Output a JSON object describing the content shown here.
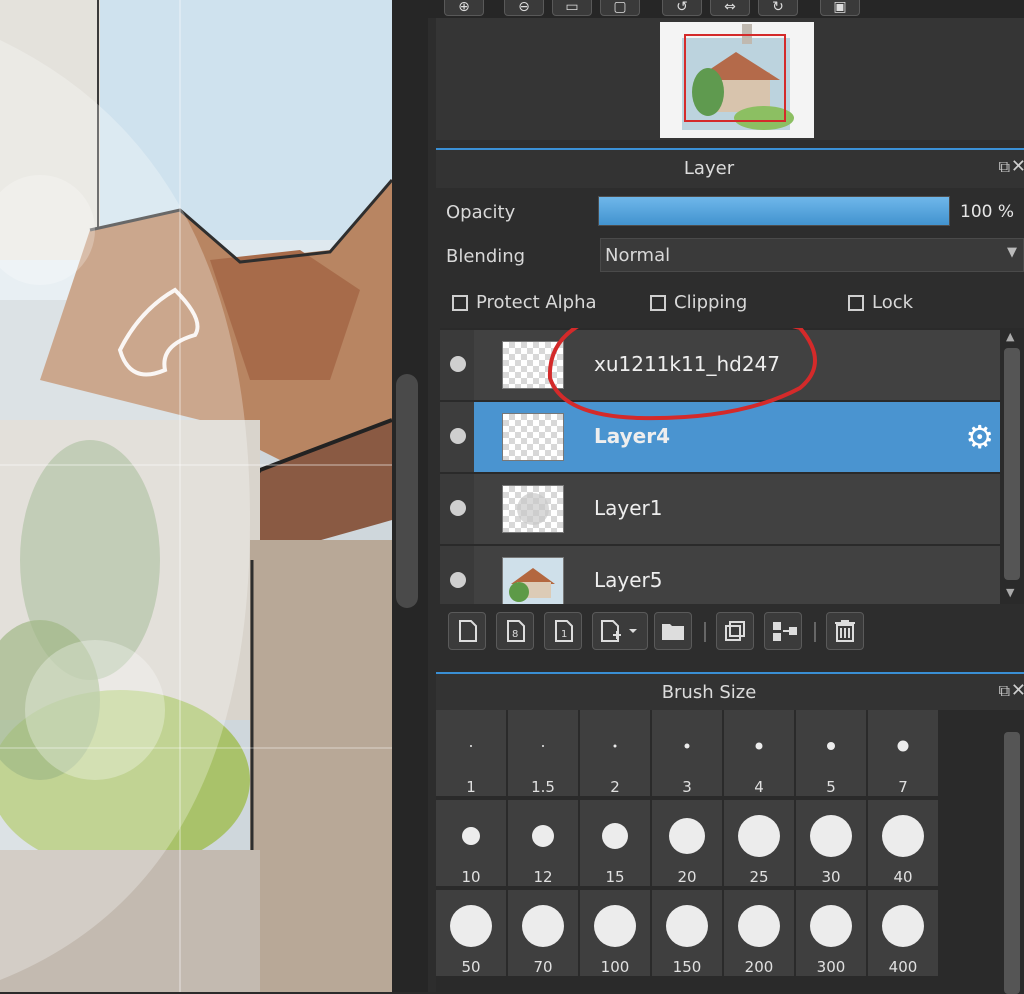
{
  "navigator": {
    "toolbar_icons": [
      "zoom-in-icon",
      "zoom-out-icon",
      "fit-icon",
      "actual-size-icon",
      "rotate-left-icon",
      "flip-icon",
      "rotate-right-icon",
      "reset-icon"
    ]
  },
  "layer_panel": {
    "title": "Layer",
    "opacity_label": "Opacity",
    "opacity_value": "100 %",
    "opacity_fraction": 1.0,
    "blending_label": "Blending",
    "blending_value": "Normal",
    "protect_alpha_label": "Protect Alpha",
    "clipping_label": "Clipping",
    "lock_label": "Lock",
    "layers": [
      {
        "name": "xu1211k11_hd247",
        "selected": false
      },
      {
        "name": "Layer4",
        "selected": true
      },
      {
        "name": "Layer1",
        "selected": false
      },
      {
        "name": "Layer5",
        "selected": false
      }
    ],
    "accent_color": "#4a94d0",
    "annotation_color": "#d42a2a"
  },
  "brush_panel": {
    "title": "Brush Size",
    "sizes": [
      "1",
      "1.5",
      "2",
      "3",
      "4",
      "5",
      "7",
      "10",
      "12",
      "15",
      "20",
      "25",
      "30",
      "40",
      "50",
      "70",
      "100",
      "150",
      "200",
      "300",
      "400"
    ]
  }
}
